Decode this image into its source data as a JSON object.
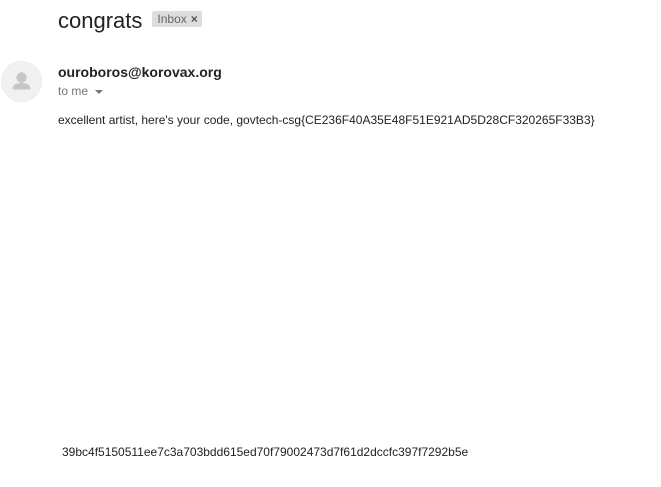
{
  "email": {
    "subject": "congrats",
    "label": {
      "text": "Inbox",
      "close_glyph": "×"
    },
    "sender": "ouroboros@korovax.org",
    "recipient_text": "to me",
    "avatar_icon": "person-icon",
    "body": "excellent artist, here's your code, govtech-csg{CE236F40A35E48F51E921AD5D28CF320265F33B3}",
    "footer_hash": "39bc4f5150511ee7c3a703bdd615ed70f79002473d7f61d2dccfc397f7292b5e"
  },
  "colors": {
    "background": "#ffffff",
    "text": "#222222",
    "muted_text": "#777777",
    "chip_background": "#dddddd",
    "avatar_background": "#f1f1f1",
    "avatar_icon": "#c6c6c6"
  }
}
